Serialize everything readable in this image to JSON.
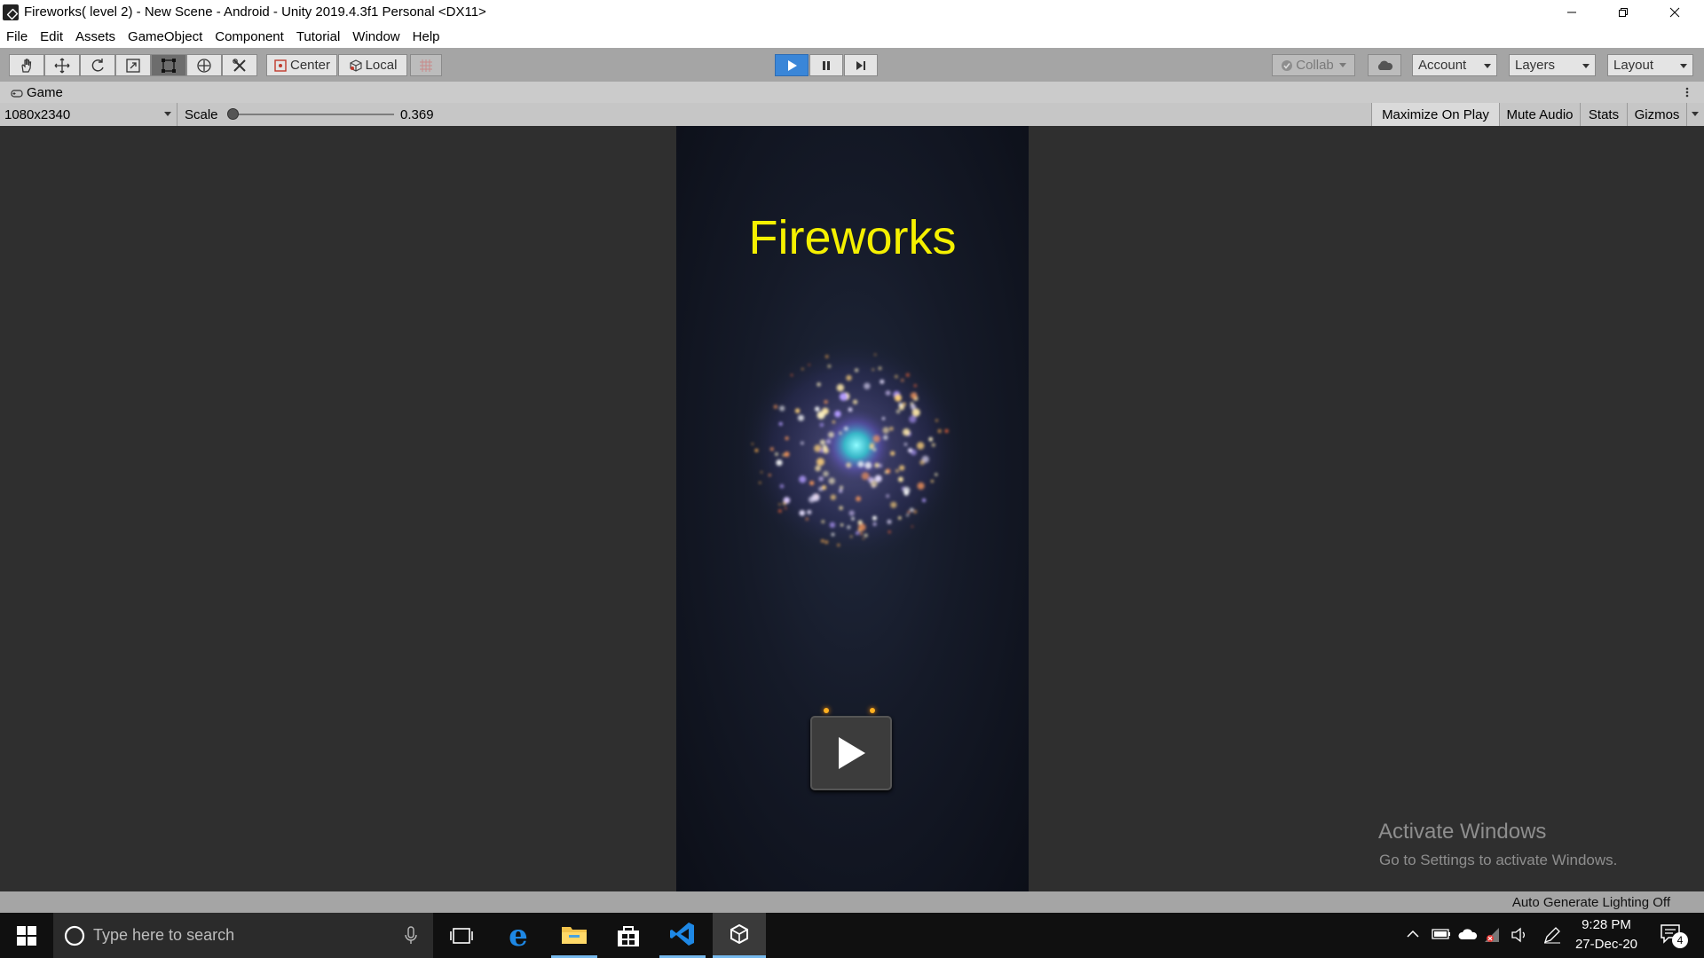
{
  "window": {
    "title": "Fireworks( level 2) - New Scene - Android - Unity 2019.4.3f1 Personal <DX11>"
  },
  "menu": [
    "File",
    "Edit",
    "Assets",
    "GameObject",
    "Component",
    "Tutorial",
    "Window",
    "Help"
  ],
  "toolbar": {
    "pivot_label": "Center",
    "space_label": "Local",
    "collab_label": "Collab",
    "account_label": "Account",
    "layers_label": "Layers",
    "layout_label": "Layout"
  },
  "tab": {
    "label": "Game"
  },
  "game_bar": {
    "resolution": "1080x2340",
    "scale_label": "Scale",
    "scale_value": "0.369",
    "maximize_label": "Maximize On Play",
    "mute_label": "Mute Audio",
    "stats_label": "Stats",
    "gizmos_label": "Gizmos"
  },
  "game": {
    "title": "Fireworks",
    "title_color": "#f5f000"
  },
  "watermark": {
    "line1": "Activate Windows",
    "line2": "Go to Settings to activate Windows."
  },
  "status": {
    "text": "Auto Generate Lighting Off"
  },
  "taskbar": {
    "search_placeholder": "Type here to search",
    "time": "9:28 PM",
    "date": "27-Dec-20",
    "notification_count": "4"
  },
  "colors": {
    "play_active": "#3a86d8",
    "toolbar": "#a5a5a5",
    "viewport": "#2f2f2f"
  }
}
